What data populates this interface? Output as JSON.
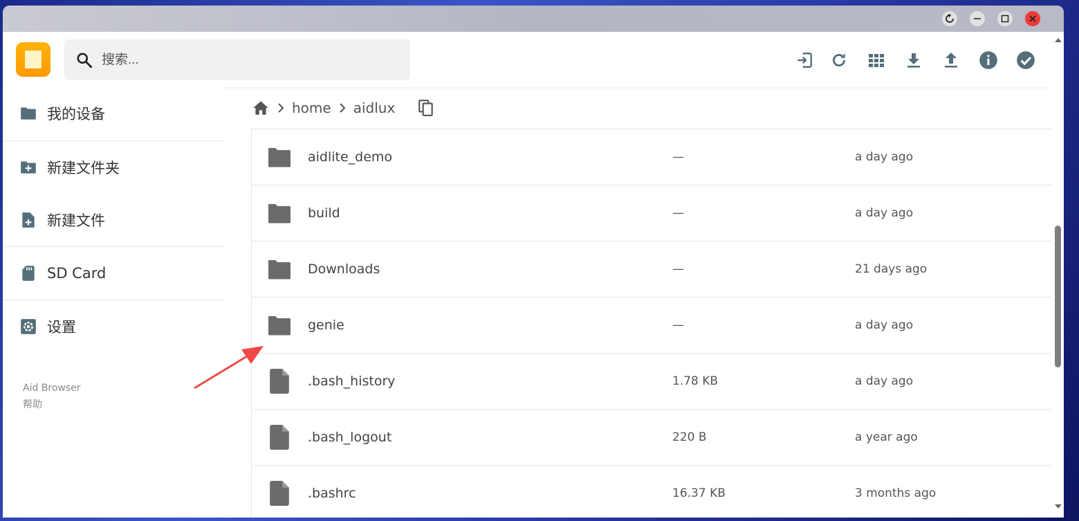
{
  "search": {
    "placeholder": "搜索..."
  },
  "toolbar": {
    "buttons": [
      "exit-icon",
      "refresh-icon",
      "grid-view-icon",
      "download-icon",
      "upload-icon",
      "info-icon",
      "select-all-icon"
    ]
  },
  "sidebar": {
    "items": [
      {
        "label": "我的设备",
        "icon": "folder-icon"
      },
      {
        "label": "新建文件夹",
        "icon": "folder-add-icon"
      },
      {
        "label": "新建文件",
        "icon": "file-add-icon"
      },
      {
        "label": "SD Card",
        "icon": "sd-card-icon"
      },
      {
        "label": "设置",
        "icon": "gear-icon"
      }
    ],
    "footer": {
      "app_name": "Aid Browser",
      "help": "帮助"
    }
  },
  "breadcrumb": {
    "parts": [
      "home",
      "aidlux"
    ]
  },
  "files": [
    {
      "name": "aidlite_demo",
      "size": "—",
      "modified": "a day ago",
      "type": "folder"
    },
    {
      "name": "build",
      "size": "—",
      "modified": "a day ago",
      "type": "folder"
    },
    {
      "name": "Downloads",
      "size": "—",
      "modified": "21 days ago",
      "type": "folder"
    },
    {
      "name": "genie",
      "size": "—",
      "modified": "a day ago",
      "type": "folder"
    },
    {
      "name": ".bash_history",
      "size": "1.78 KB",
      "modified": "a day ago",
      "type": "file"
    },
    {
      "name": ".bash_logout",
      "size": "220 B",
      "modified": "a year ago",
      "type": "file"
    },
    {
      "name": ".bashrc",
      "size": "16.37 KB",
      "modified": "3 months ago",
      "type": "file"
    }
  ],
  "colors": {
    "accent": "#ff9a00",
    "icon": "#546e7a",
    "file_icon": "#6b6b6b",
    "close_button": "#ee3a3a",
    "annotation_arrow": "#f04848"
  }
}
